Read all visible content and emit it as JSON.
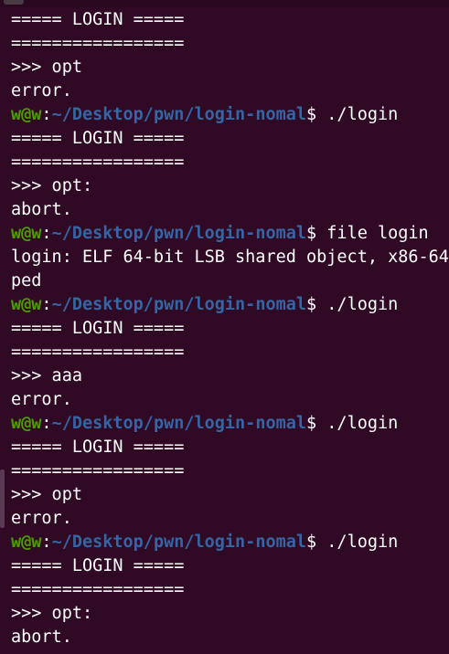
{
  "terminal": {
    "colors": {
      "background": "#300a24",
      "text": "#ffffff",
      "user_host": "#4e9a06",
      "path": "#3465a4"
    },
    "lines": [
      {
        "type": "text",
        "text": "===== LOGIN ====="
      },
      {
        "type": "text",
        "text": "================="
      },
      {
        "type": "text",
        "text": ">>> opt"
      },
      {
        "type": "text",
        "text": "error."
      },
      {
        "type": "prompt",
        "user_host": "w@w",
        "sep": ":",
        "path": "~/Desktop/pwn/login-nomal",
        "symbol": "$",
        "command": " ./login"
      },
      {
        "type": "text",
        "text": "===== LOGIN ====="
      },
      {
        "type": "text",
        "text": "================="
      },
      {
        "type": "text",
        "text": ">>> opt:"
      },
      {
        "type": "text",
        "text": "abort."
      },
      {
        "type": "prompt",
        "user_host": "w@w",
        "sep": ":",
        "path": "~/Desktop/pwn/login-nomal",
        "symbol": "$",
        "command": " file login"
      },
      {
        "type": "text",
        "text": "login: ELF 64-bit LSB shared object, x86-64"
      },
      {
        "type": "text",
        "text": "ped"
      },
      {
        "type": "prompt",
        "user_host": "w@w",
        "sep": ":",
        "path": "~/Desktop/pwn/login-nomal",
        "symbol": "$",
        "command": " ./login"
      },
      {
        "type": "text",
        "text": "===== LOGIN ====="
      },
      {
        "type": "text",
        "text": "================="
      },
      {
        "type": "text",
        "text": ">>> aaa"
      },
      {
        "type": "text",
        "text": "error."
      },
      {
        "type": "prompt",
        "user_host": "w@w",
        "sep": ":",
        "path": "~/Desktop/pwn/login-nomal",
        "symbol": "$",
        "command": " ./login"
      },
      {
        "type": "text",
        "text": "===== LOGIN ====="
      },
      {
        "type": "text",
        "text": "================="
      },
      {
        "type": "text",
        "text": ">>> opt"
      },
      {
        "type": "text",
        "text": "error."
      },
      {
        "type": "prompt",
        "user_host": "w@w",
        "sep": ":",
        "path": "~/Desktop/pwn/login-nomal",
        "symbol": "$",
        "command": " ./login"
      },
      {
        "type": "text",
        "text": "===== LOGIN ====="
      },
      {
        "type": "text",
        "text": "================="
      },
      {
        "type": "text",
        "text": ">>> opt:"
      },
      {
        "type": "text",
        "text": "abort."
      }
    ]
  }
}
